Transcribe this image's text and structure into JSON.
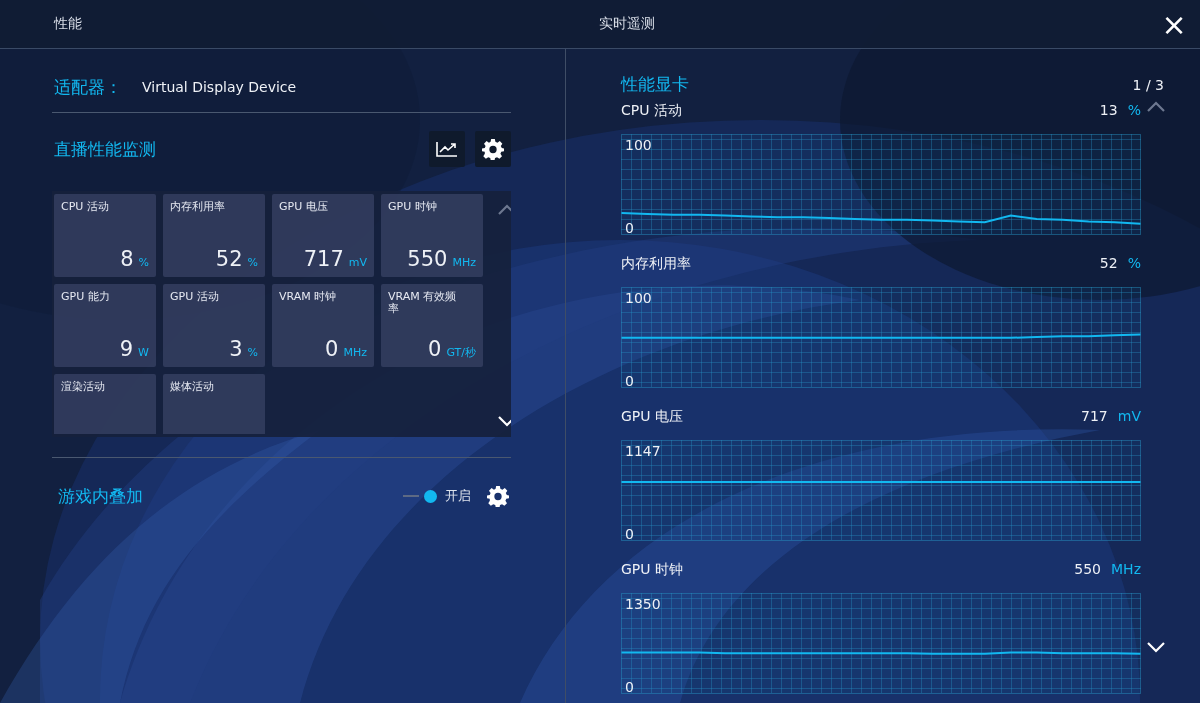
{
  "header": {
    "left_title": "性能",
    "center_title": "实时遥测",
    "close": "×"
  },
  "adapter": {
    "label": "适配器：",
    "value": "Virtual Display Device"
  },
  "live_monitor": {
    "title": "直播性能监测",
    "tiles": [
      {
        "label": "CPU 活动",
        "value": "8",
        "unit": "%"
      },
      {
        "label": "内存利用率",
        "value": "52",
        "unit": "%"
      },
      {
        "label": "GPU 电压",
        "value": "717",
        "unit": "mV"
      },
      {
        "label": "GPU 时钟",
        "value": "550",
        "unit": "MHz"
      },
      {
        "label": "GPU 能力",
        "value": "9",
        "unit": "W"
      },
      {
        "label": "GPU 活动",
        "value": "3",
        "unit": "%"
      },
      {
        "label": "VRAM 时钟",
        "value": "0",
        "unit": "MHz"
      },
      {
        "label": "VRAM 有效频率",
        "value": "0",
        "unit": "GT/秒"
      },
      {
        "label": "渲染活动"
      },
      {
        "label": "媒体活动"
      }
    ],
    "scroll_up": {
      "disabled": true
    },
    "scroll_down": {
      "disabled": false
    }
  },
  "overlay": {
    "title": "游戏内叠加",
    "toggle": {
      "on": true,
      "label": "开启"
    }
  },
  "telemetry": {
    "title": "性能显卡",
    "page": "1 / 3",
    "scroll_up": {
      "disabled": true
    },
    "scroll_down": {
      "disabled": false
    },
    "charts": [
      {
        "value": "13",
        "unit": "%",
        "chart_data": {
          "type": "line",
          "grid": true,
          "ylim": [
            0,
            100
          ],
          "yticks": [
            0,
            100
          ],
          "series": [
            {
              "name": "CPU 活动",
              "color": "#12b8f0",
              "values": [
                18,
                17,
                16,
                16,
                15,
                14,
                13,
                13,
                12,
                11,
                10,
                10,
                9,
                8,
                7,
                15,
                11,
                10,
                8,
                7,
                5
              ]
            }
          ]
        }
      },
      {
        "value": "52",
        "unit": "%",
        "chart_data": {
          "type": "line",
          "grid": true,
          "ylim": [
            0,
            100
          ],
          "yticks": [
            0,
            100
          ],
          "series": [
            {
              "name": "内存利用率",
              "color": "#12b8f0",
              "values": [
                52,
                52,
                52,
                52,
                52,
                52,
                52,
                52,
                52,
                52,
                52,
                52,
                52,
                52,
                52,
                52,
                53,
                54,
                54,
                55,
                56
              ]
            }
          ]
        }
      },
      {
        "value": "717",
        "unit": "mV",
        "chart_data": {
          "type": "line",
          "grid": true,
          "ylim": [
            0,
            1147
          ],
          "yticks": [
            0,
            1147
          ],
          "series": [
            {
              "name": "GPU 电压",
              "color": "#12b8f0",
              "values": [
                717,
                717,
                717,
                717,
                717,
                717,
                717,
                717,
                717,
                717,
                717,
                717,
                717,
                717,
                717,
                717,
                717,
                717,
                717,
                717,
                717
              ]
            }
          ]
        }
      },
      {
        "value": "550",
        "unit": "MHz",
        "chart_data": {
          "type": "line",
          "grid": true,
          "ylim": [
            0,
            1350
          ],
          "yticks": [
            0,
            1350
          ],
          "series": [
            {
              "name": "GPU 时钟",
              "color": "#12b8f0",
              "values": [
                560,
                560,
                560,
                560,
                550,
                550,
                550,
                550,
                550,
                550,
                550,
                550,
                540,
                540,
                540,
                560,
                560,
                550,
                550,
                550,
                540
              ]
            }
          ]
        }
      }
    ]
  }
}
